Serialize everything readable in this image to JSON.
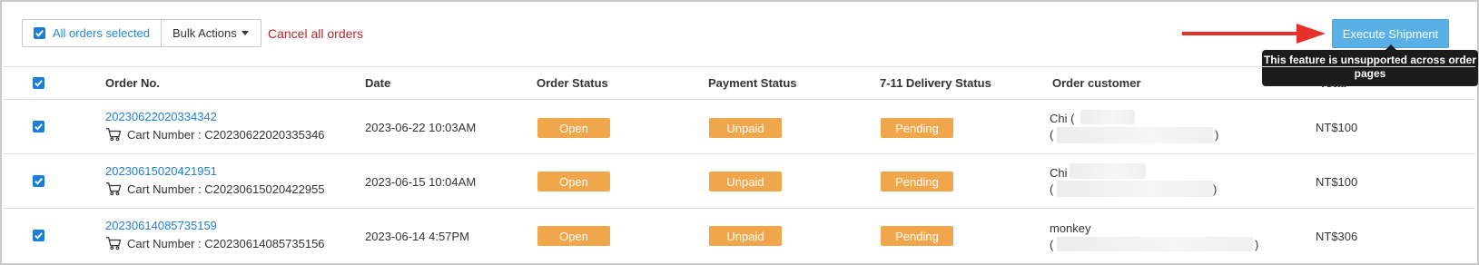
{
  "toolbar": {
    "all_selected_label": "All orders selected",
    "bulk_actions_label": "Bulk Actions",
    "cancel_all_label": "Cancel all orders"
  },
  "execute": {
    "label": "Execute Shipment",
    "tooltip": "This feature is unsupported across order pages"
  },
  "table": {
    "headers": [
      "Order No.",
      "Date",
      "Order Status",
      "Payment Status",
      "7-11 Delivery Status",
      "Order customer",
      "Total"
    ],
    "rows": [
      {
        "order_no": "20230622020334342",
        "cart": "Cart Number : C20230622020335346",
        "date": "2023-06-22 10:03AM",
        "order_status": "Open",
        "payment_status": "Unpaid",
        "delivery_status": "Pending",
        "customer": "Chi (",
        "paren_open": "(",
        "paren_close": ")",
        "total": "NT$100"
      },
      {
        "order_no": "20230615020421951",
        "cart": "Cart Number : C20230615020422955",
        "date": "2023-06-15 10:04AM",
        "order_status": "Open",
        "payment_status": "Unpaid",
        "delivery_status": "Pending",
        "customer": "Chi",
        "paren_open": "(",
        "paren_close": ")",
        "total": "NT$100"
      },
      {
        "order_no": "20230614085735159",
        "cart": "Cart Number : C20230614085735156",
        "date": "2023-06-14 4:57PM",
        "order_status": "Open",
        "payment_status": "Unpaid",
        "delivery_status": "Pending",
        "customer": "monkey",
        "paren_open": "(",
        "paren_close": ")",
        "total": "NT$306"
      }
    ]
  },
  "colors": {
    "accent": "#1e7fd8",
    "badge": "#f0a64b",
    "cancel": "#b5282e",
    "execute": "#58b0e6",
    "arrow": "#e8302a"
  }
}
